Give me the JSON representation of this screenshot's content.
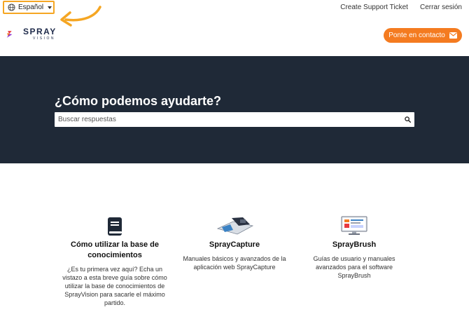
{
  "topbar": {
    "language": "Español",
    "links": [
      "Create Support Ticket",
      "Cerrar sesión"
    ]
  },
  "header": {
    "logo_text": "SPRAY",
    "logo_subtext": "VISION",
    "contact_button": "Ponte en contacto"
  },
  "hero": {
    "title": "¿Cómo podemos ayudarte?",
    "search_placeholder": "Buscar respuestas"
  },
  "categories": [
    {
      "title": "Cómo utilizar la base de conocimientos",
      "description": "¿Es tu primera vez aquí? Echa un vistazo a esta breve guía sobre cómo utilizar la base de conocimientos de SprayVision para sacarle el máximo partido.",
      "icon": "book-icon"
    },
    {
      "title": "SprayCapture",
      "description": "Manuales básicos y avanzados de la aplicación web SprayCapture",
      "icon": "scanner-icon"
    },
    {
      "title": "SprayBrush",
      "description": "Guías de usuario y manuales avanzados para el software SprayBrush",
      "icon": "monitor-icon"
    }
  ],
  "colors": {
    "accent": "#f47b20",
    "highlight": "#f5a623",
    "hero_bg": "#1f2937"
  }
}
